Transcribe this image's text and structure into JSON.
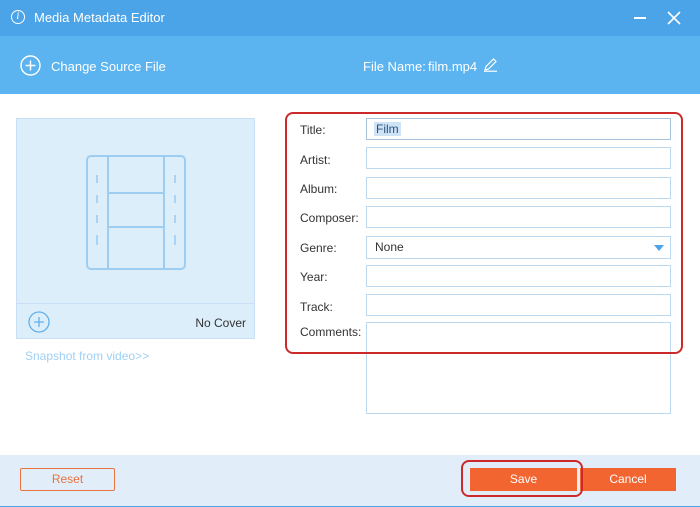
{
  "window": {
    "title": "Media Metadata Editor"
  },
  "header": {
    "change_source_label": "Change Source File",
    "file_name_label": "File Name:",
    "file_name_value": "film.mp4"
  },
  "cover": {
    "no_cover_label": "No Cover",
    "snapshot_link": "Snapshot from video>>"
  },
  "form": {
    "title_label": "Title:",
    "title_value": "Film",
    "artist_label": "Artist:",
    "artist_value": "",
    "album_label": "Album:",
    "album_value": "",
    "composer_label": "Composer:",
    "composer_value": "",
    "genre_label": "Genre:",
    "genre_value": "None",
    "year_label": "Year:",
    "year_value": "",
    "track_label": "Track:",
    "track_value": "",
    "comments_label": "Comments:",
    "comments_value": ""
  },
  "footer": {
    "reset_label": "Reset",
    "save_label": "Save",
    "cancel_label": "Cancel"
  },
  "icons": {
    "info": "info-icon",
    "minimize": "minimize-icon",
    "close": "close-icon",
    "add": "plus-circle-icon",
    "edit": "pencil-icon",
    "film": "film-icon",
    "dropdown": "chevron-down-icon"
  },
  "colors": {
    "titlebar": "#4ba3e8",
    "header": "#5bb3ef",
    "accent_orange": "#f26531",
    "highlight_red": "#cc2a2a",
    "cover_bg": "#ddeefb",
    "footer_bg": "#e1eefa"
  }
}
